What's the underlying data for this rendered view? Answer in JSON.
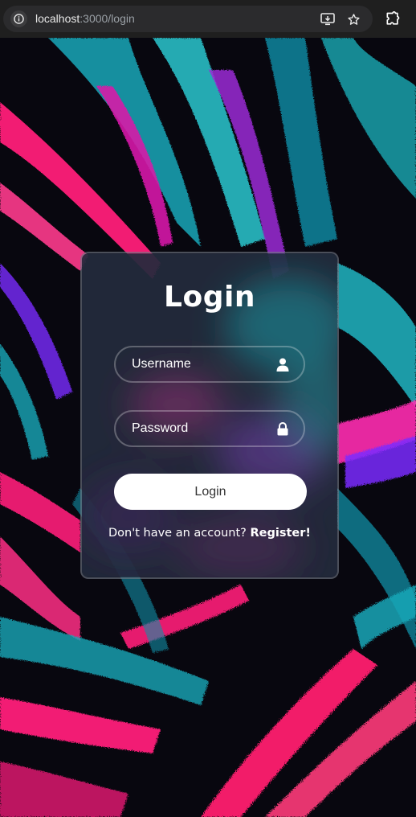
{
  "browser": {
    "url_host": "localhost",
    "url_path": ":3000/login",
    "icons": [
      "site-info-icon",
      "install-app-icon",
      "bookmark-star-icon",
      "extensions-icon"
    ]
  },
  "login": {
    "title": "Login",
    "username_placeholder": "Username",
    "password_placeholder": "Password",
    "submit_label": "Login",
    "register_prompt": "Don't have an account?",
    "register_link": "Register!",
    "icons": [
      "user-icon",
      "lock-icon"
    ]
  },
  "colors": {
    "accent_pink": "#ff1f7a",
    "accent_teal": "#1fb5c2",
    "accent_purple": "#7a2cff",
    "card_border": "#5a6070",
    "button_bg": "#ffffff"
  }
}
